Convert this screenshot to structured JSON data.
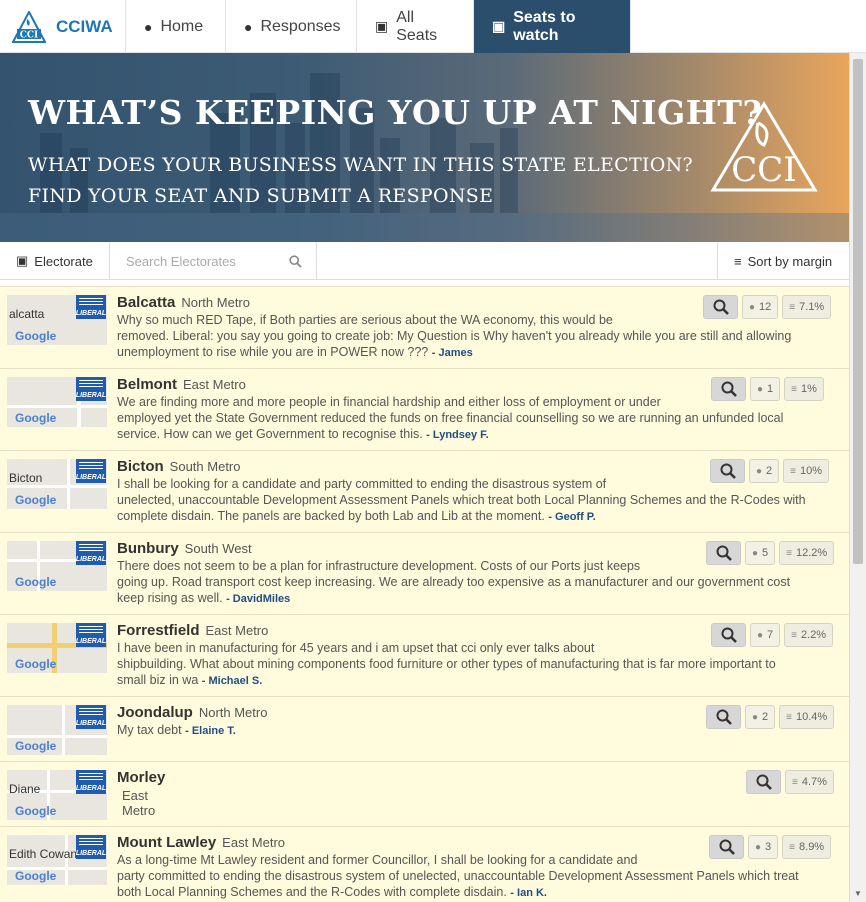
{
  "nav": {
    "brand": "CCIWA",
    "items": [
      {
        "label": "Home",
        "icon": "comment-icon"
      },
      {
        "label": "Responses",
        "icon": "comments-icon"
      },
      {
        "label": "All Seats",
        "icon": "map-icon"
      },
      {
        "label": "Seats to watch",
        "icon": "map-icon",
        "active": true
      }
    ]
  },
  "hero": {
    "title": "WHAT’S KEEPING YOU UP AT NIGHT?",
    "line1": "WHAT DOES YOUR BUSINESS WANT IN THIS STATE ELECTION?",
    "line2": "FIND YOUR SEAT AND SUBMIT A RESPONSE",
    "logo_text": "CCI"
  },
  "toolbar": {
    "electorate_label": "Electorate",
    "search_placeholder": "Search Electorates",
    "sort_label": "Sort by margin"
  },
  "map_labels": {
    "google": "Google",
    "party": "LIBERAL"
  },
  "seats": [
    {
      "name": "Balcatta",
      "region": "North Metro",
      "map_text": "alcatta",
      "responses": "12",
      "margin": "7.1%",
      "lines": [
        "Why so much RED Tape, if Both parties are serious about the WA economy, this would be",
        "removed. Liberal: you say you going to create job: My Question is Why haven't you already while you are still and allowing",
        "unemployment to rise while you are in POWER now ??? "
      ],
      "author": "- James"
    },
    {
      "name": "Belmont",
      "region": "East Metro",
      "map_text": "",
      "responses": "1",
      "margin": "1%",
      "lines": [
        "We are finding more and more people in financial hardship and either loss of employment or under",
        "employed yet the State Government reduced the funds on free financial counselling so we are running an unfunded local",
        "service. How can we get Government to recognise this. "
      ],
      "author": "- Lyndsey F."
    },
    {
      "name": "Bicton",
      "region": "South Metro",
      "map_text": "Bicton",
      "responses": "2",
      "margin": "10%",
      "lines": [
        "I shall be looking for a candidate and party committed to ending the disastrous system of",
        "unelected, unaccountable Development Assessment Panels which treat both Local Planning Schemes and the R-Codes with",
        "complete disdain. The panels are backed by both Lab and Lib at the moment. "
      ],
      "author": "- Geoff P."
    },
    {
      "name": "Bunbury",
      "region": "South West",
      "map_text": "",
      "responses": "5",
      "margin": "12.2%",
      "lines": [
        "There does not seem to be a plan for infrastructure development. Costs of our Ports just keeps",
        "going up. Road transport cost keep increasing. We are already too expensive as a manufacturer and our government cost",
        "keep rising as well. "
      ],
      "author": "- DavidMiles"
    },
    {
      "name": "Forrestfield",
      "region": "East Metro",
      "map_text": "",
      "responses": "7",
      "margin": "2.2%",
      "lines": [
        "I have been in manufacturing for 45 years and i am upset that cci only ever talks about",
        "shipbuilding. What about mining components food furniture or other types of manufacturing that is far more important to",
        "small biz in wa "
      ],
      "author": "- Michael S."
    },
    {
      "name": "Joondalup",
      "region": "North Metro",
      "map_text": "",
      "responses": "2",
      "margin": "10.4%",
      "lines": [
        "My tax debt "
      ],
      "author": "- Elaine T."
    },
    {
      "name": "Morley",
      "region": "East Metro",
      "map_text": "Diane",
      "responses": "",
      "margin": "4.7%",
      "lines": [],
      "author": ""
    },
    {
      "name": "Mount Lawley",
      "region": "East Metro",
      "map_text": "Edith Cowan",
      "responses": "3",
      "margin": "8.9%",
      "lines": [
        "As a long-time Mt Lawley resident and former Councillor, I shall be looking for a candidate and",
        "party committed to ending the disastrous system of unelected, unaccountable Development Assessment Panels which treat",
        "both Local Planning Schemes and the R-Codes with complete disdain. "
      ],
      "author": "- Ian K."
    }
  ]
}
